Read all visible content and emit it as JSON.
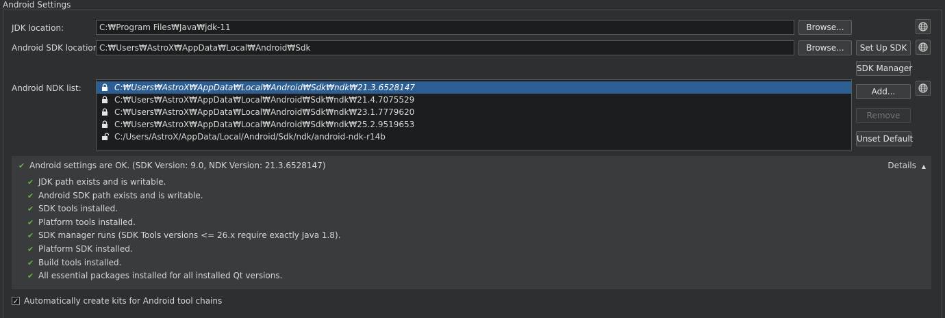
{
  "group_title": "Android Settings",
  "jdk": {
    "label": "JDK location:",
    "value": "C:₩Program Files₩Java₩jdk-11",
    "browse": "Browse..."
  },
  "sdk": {
    "label": "Android SDK location:",
    "value": "C:₩Users₩AstroX₩AppData₩Local₩Android₩Sdk",
    "browse": "Browse...",
    "setup": "Set Up SDK",
    "manager": "SDK Manager"
  },
  "ndk": {
    "label": "Android NDK list:",
    "items": [
      {
        "path": "C:₩Users₩AstroX₩AppData₩Local₩Android₩Sdk₩ndk₩21.3.6528147",
        "locked": true,
        "selected": true
      },
      {
        "path": "C:₩Users₩AstroX₩AppData₩Local₩Android₩Sdk₩ndk₩21.4.7075529",
        "locked": true,
        "selected": false
      },
      {
        "path": "C:₩Users₩AstroX₩AppData₩Local₩Android₩Sdk₩ndk₩23.1.7779620",
        "locked": true,
        "selected": false
      },
      {
        "path": "C:₩Users₩AstroX₩AppData₩Local₩Android₩Sdk₩ndk₩25.2.9519653",
        "locked": true,
        "selected": false
      },
      {
        "path": "C:/Users/AstroX/AppData/Local/Android/Sdk/ndk/android-ndk-r14b",
        "locked": false,
        "selected": false
      }
    ],
    "add": "Add...",
    "remove": "Remove",
    "unset_default": "Unset Default"
  },
  "status": {
    "summary": "Android settings are OK. (SDK Version: 9.0, NDK Version: 21.3.6528147)",
    "details": "Details",
    "checks": [
      "JDK path exists and is writable.",
      "Android SDK path exists and is writable.",
      "SDK tools installed.",
      "Platform tools installed.",
      "SDK manager runs (SDK Tools versions <= 26.x require exactly Java 1.8).",
      "Platform SDK installed.",
      "Build tools installed.",
      "All essential packages installed for all installed Qt versions."
    ]
  },
  "auto_kits": {
    "label": "Automatically create kits for Android tool chains",
    "checked": true
  },
  "icons": {
    "globe": "globe-icon",
    "lock": "lock-icon",
    "unlock": "unlock-icon",
    "check": "checkmark-icon",
    "chevron": "chevron-up-icon"
  },
  "colors": {
    "accent_selection": "#2c5d93",
    "check_green": "#6ab04c",
    "background": "#2e2f30"
  }
}
